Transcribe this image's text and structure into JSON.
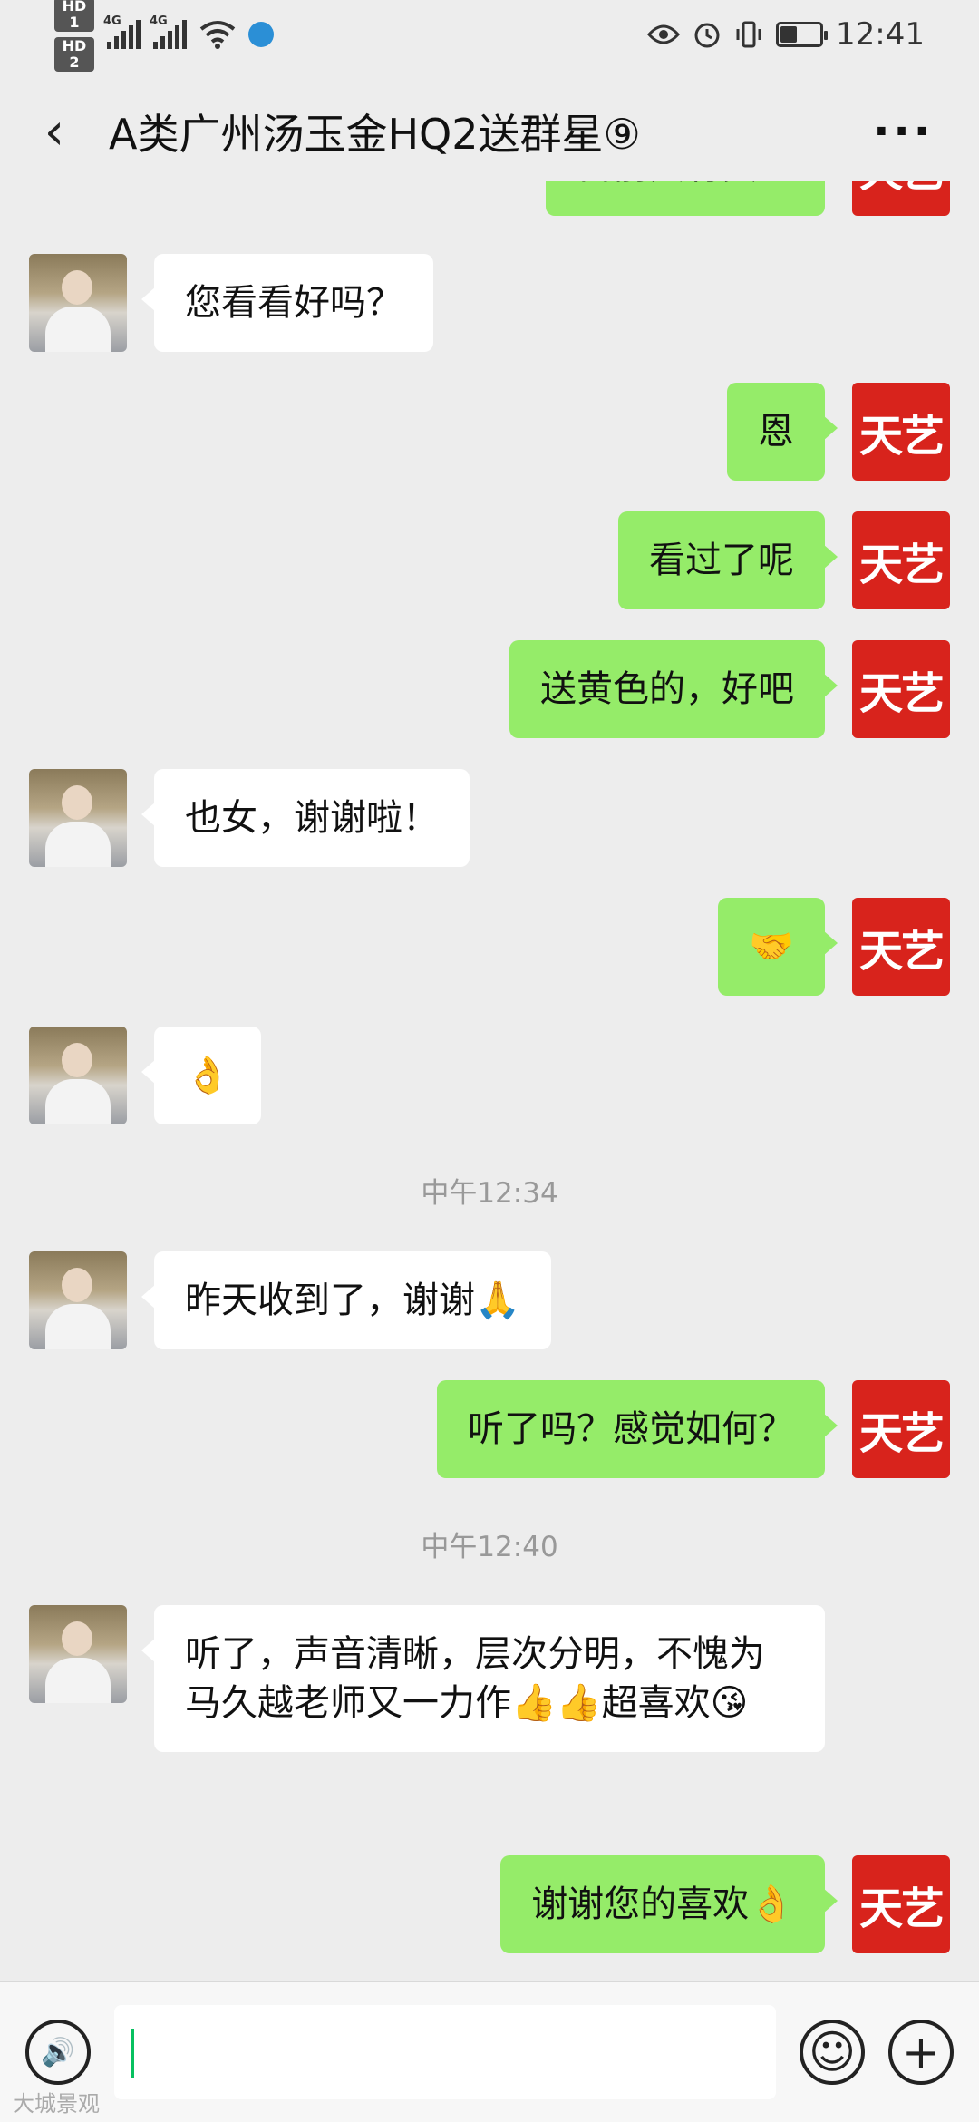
{
  "status_bar": {
    "hd1": "HD 1",
    "hd2": "HD 2",
    "net1": "4G",
    "net2": "4G",
    "time": "12:41",
    "icons": [
      "eye-icon",
      "alarm-icon",
      "vibrate-icon",
      "battery-icon",
      "wifi-icon",
      "globe-icon"
    ]
  },
  "header": {
    "back_icon": "‹",
    "title": "A类广州汤玉金HQ2送群星⑨",
    "more_icon": "···"
  },
  "avatars": {
    "self_text": "天艺"
  },
  "messages": [
    {
      "side": "right",
      "text": "目前只有黄色"
    },
    {
      "side": "left",
      "text": "您看看好吗？"
    },
    {
      "side": "right",
      "text": "恩"
    },
    {
      "side": "right",
      "text": "看过了呢"
    },
    {
      "side": "right",
      "text": "送黄色的，好吧"
    },
    {
      "side": "left",
      "text": "也女，谢谢啦！"
    },
    {
      "side": "right",
      "text": "🤝"
    },
    {
      "side": "left",
      "text": "👌"
    },
    {
      "side": "time",
      "text": "中午12:34"
    },
    {
      "side": "left",
      "text": "昨天收到了，谢谢🙏"
    },
    {
      "side": "right",
      "text": "听了吗？感觉如何？"
    },
    {
      "side": "time",
      "text": "中午12:40"
    },
    {
      "side": "left",
      "text": "听了，声音清晰，层次分明，不愧为马久越老师又一力作👍👍超喜欢😘"
    },
    {
      "side": "right",
      "text": "谢谢您的喜欢👌"
    }
  ],
  "input_bar": {
    "voice_icon": "🔊",
    "emoji_icon": "☺",
    "plus_icon": "+",
    "input_value": ""
  },
  "watermark": "大城景观"
}
